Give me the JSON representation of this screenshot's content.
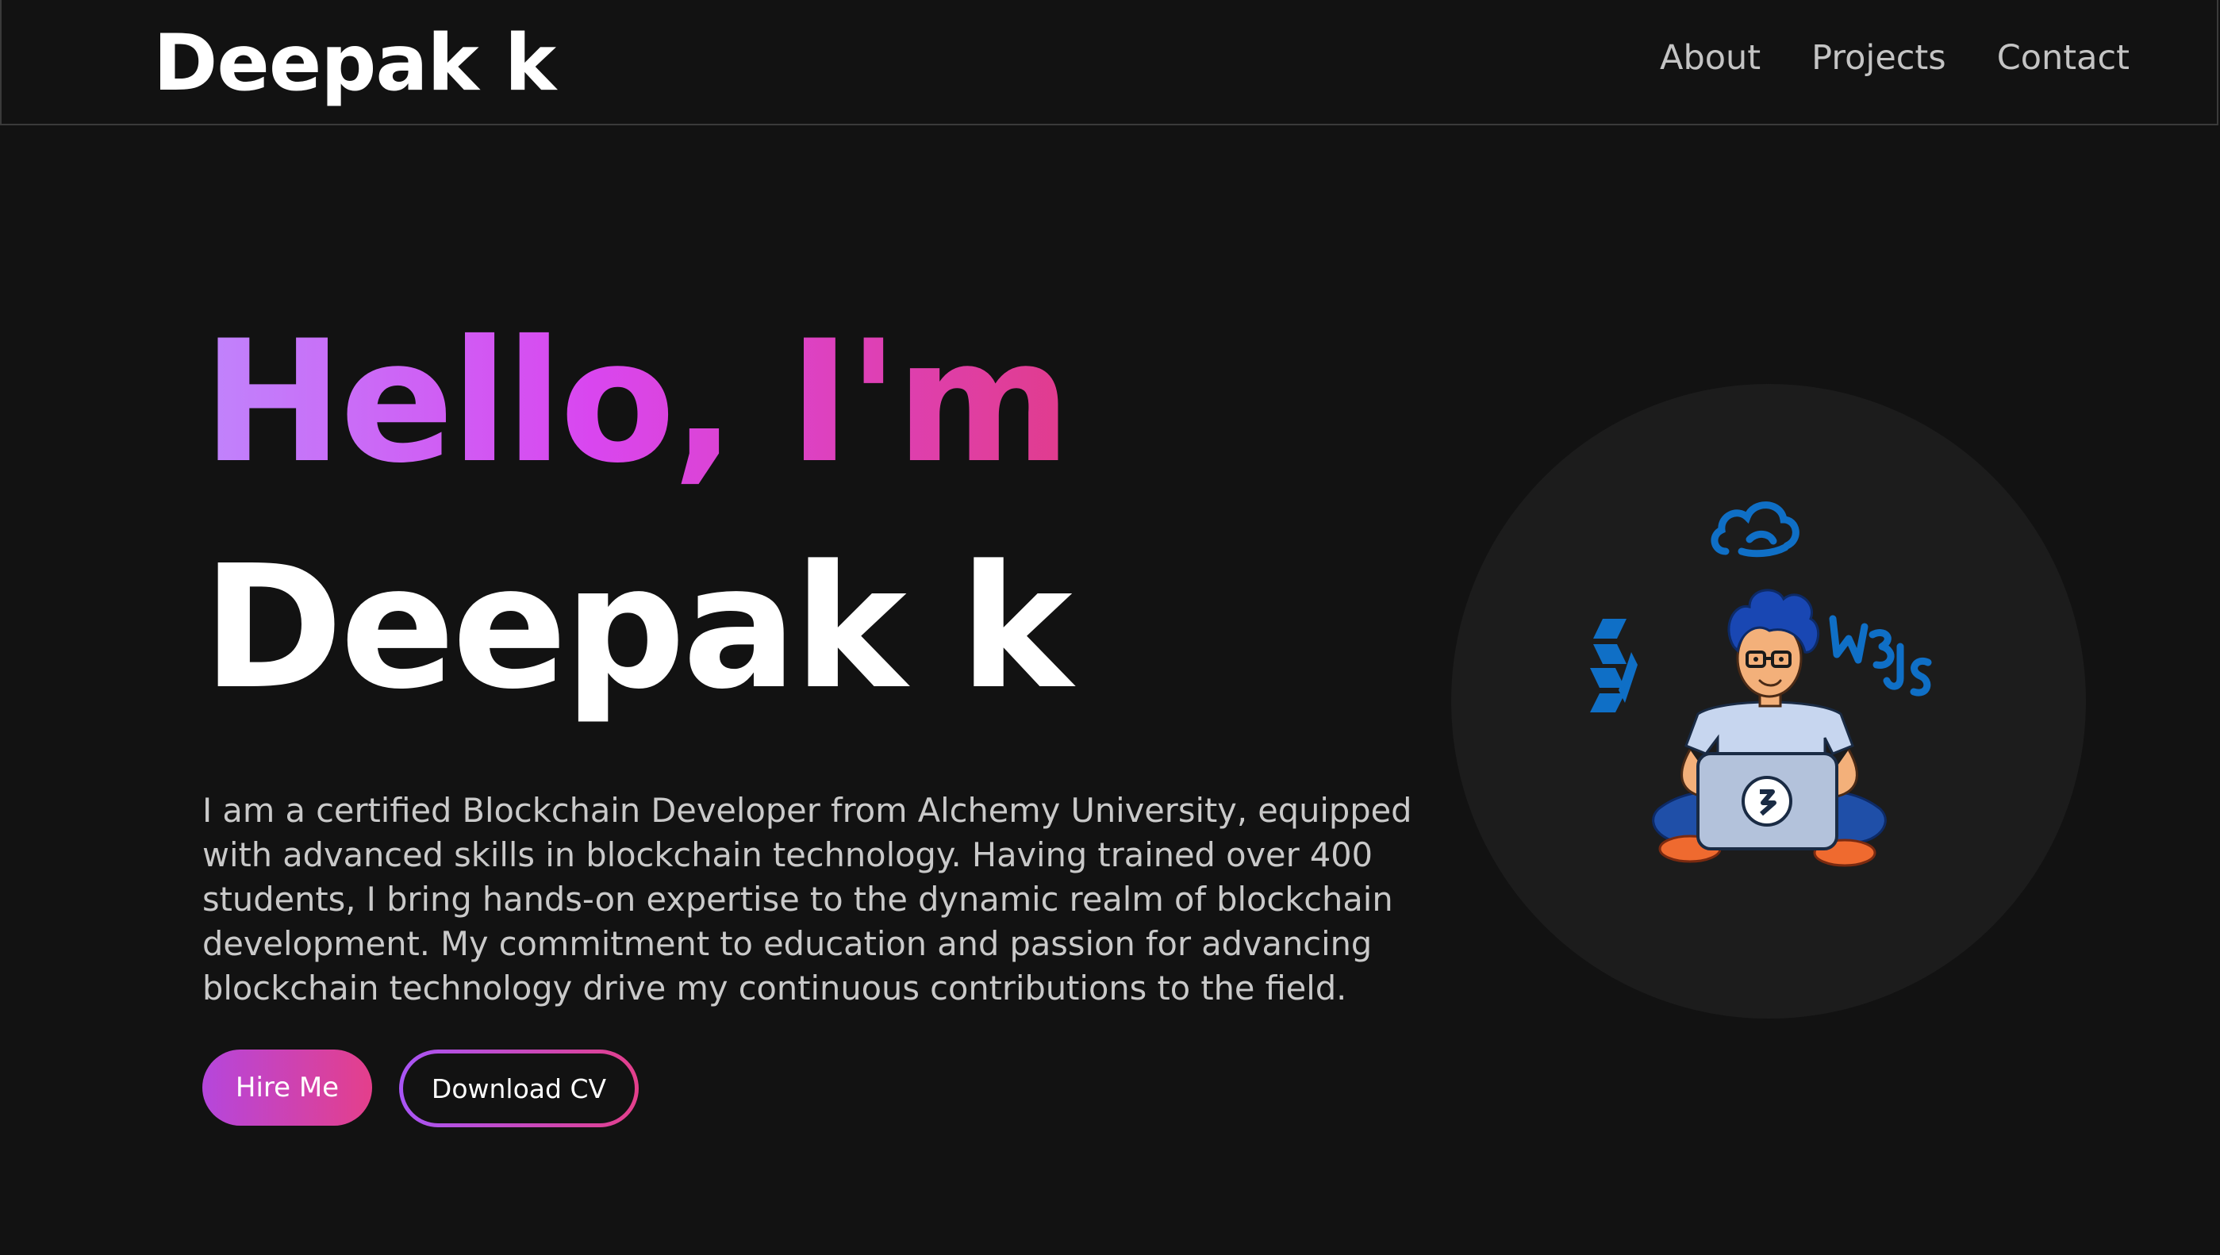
{
  "header": {
    "brand": "Deepak k",
    "nav": [
      {
        "label": "About"
      },
      {
        "label": "Projects"
      },
      {
        "label": "Contact"
      }
    ]
  },
  "hero": {
    "greeting": "Hello, I'm",
    "name": "Deepak k",
    "bio": "I am a certified Blockchain Developer from Alchemy University, equipped with advanced skills in blockchain technology. Having trained over 400 students, I bring hands-on expertise to the dynamic realm of blockchain development. My commitment to education and passion for advancing blockchain technology drive my continuous contributions to the field.",
    "buttons": {
      "hire": "Hire Me",
      "cv": "Download CV"
    }
  },
  "illustration": {
    "icons": [
      "cloud-icon",
      "solidity-icon",
      "web3js-icon"
    ],
    "colors": {
      "accent_blue": "#0f6fc6",
      "hair": "#1947b3",
      "shirt": "#c7d6ef",
      "pants": "#1f4fa8",
      "shoes": "#ef6a2f"
    }
  },
  "theme": {
    "background": "#121212",
    "gradient_start": "#c084fc",
    "gradient_end": "#e13c8d"
  }
}
